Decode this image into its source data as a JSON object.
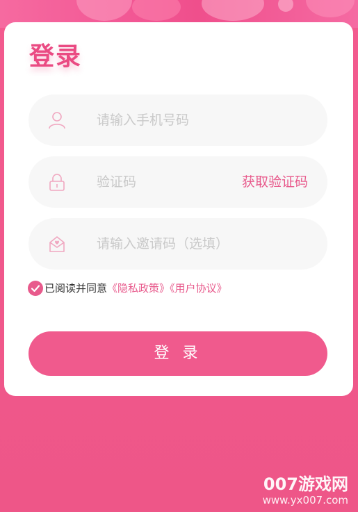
{
  "login": {
    "title": "登录",
    "phone": {
      "placeholder": "请输入手机号码",
      "icon": "user-icon"
    },
    "code": {
      "placeholder": "验证码",
      "icon": "lock-icon",
      "get_code_label": "获取验证码"
    },
    "invite": {
      "placeholder": "请输入邀请码（选填）",
      "icon": "mail-icon"
    },
    "agreement": {
      "checked": true,
      "prefix": "已阅读并同意",
      "privacy_label": "《隐私政策》",
      "terms_label": "《用户协议》"
    },
    "submit_label": "登 录"
  },
  "watermark": {
    "main": "007游戏网",
    "url": "www.yx007.com"
  },
  "colors": {
    "accent": "#e85a8c",
    "background": "#f35a8f",
    "field_bg": "#f7f7f7",
    "placeholder": "#c9c9c9"
  }
}
